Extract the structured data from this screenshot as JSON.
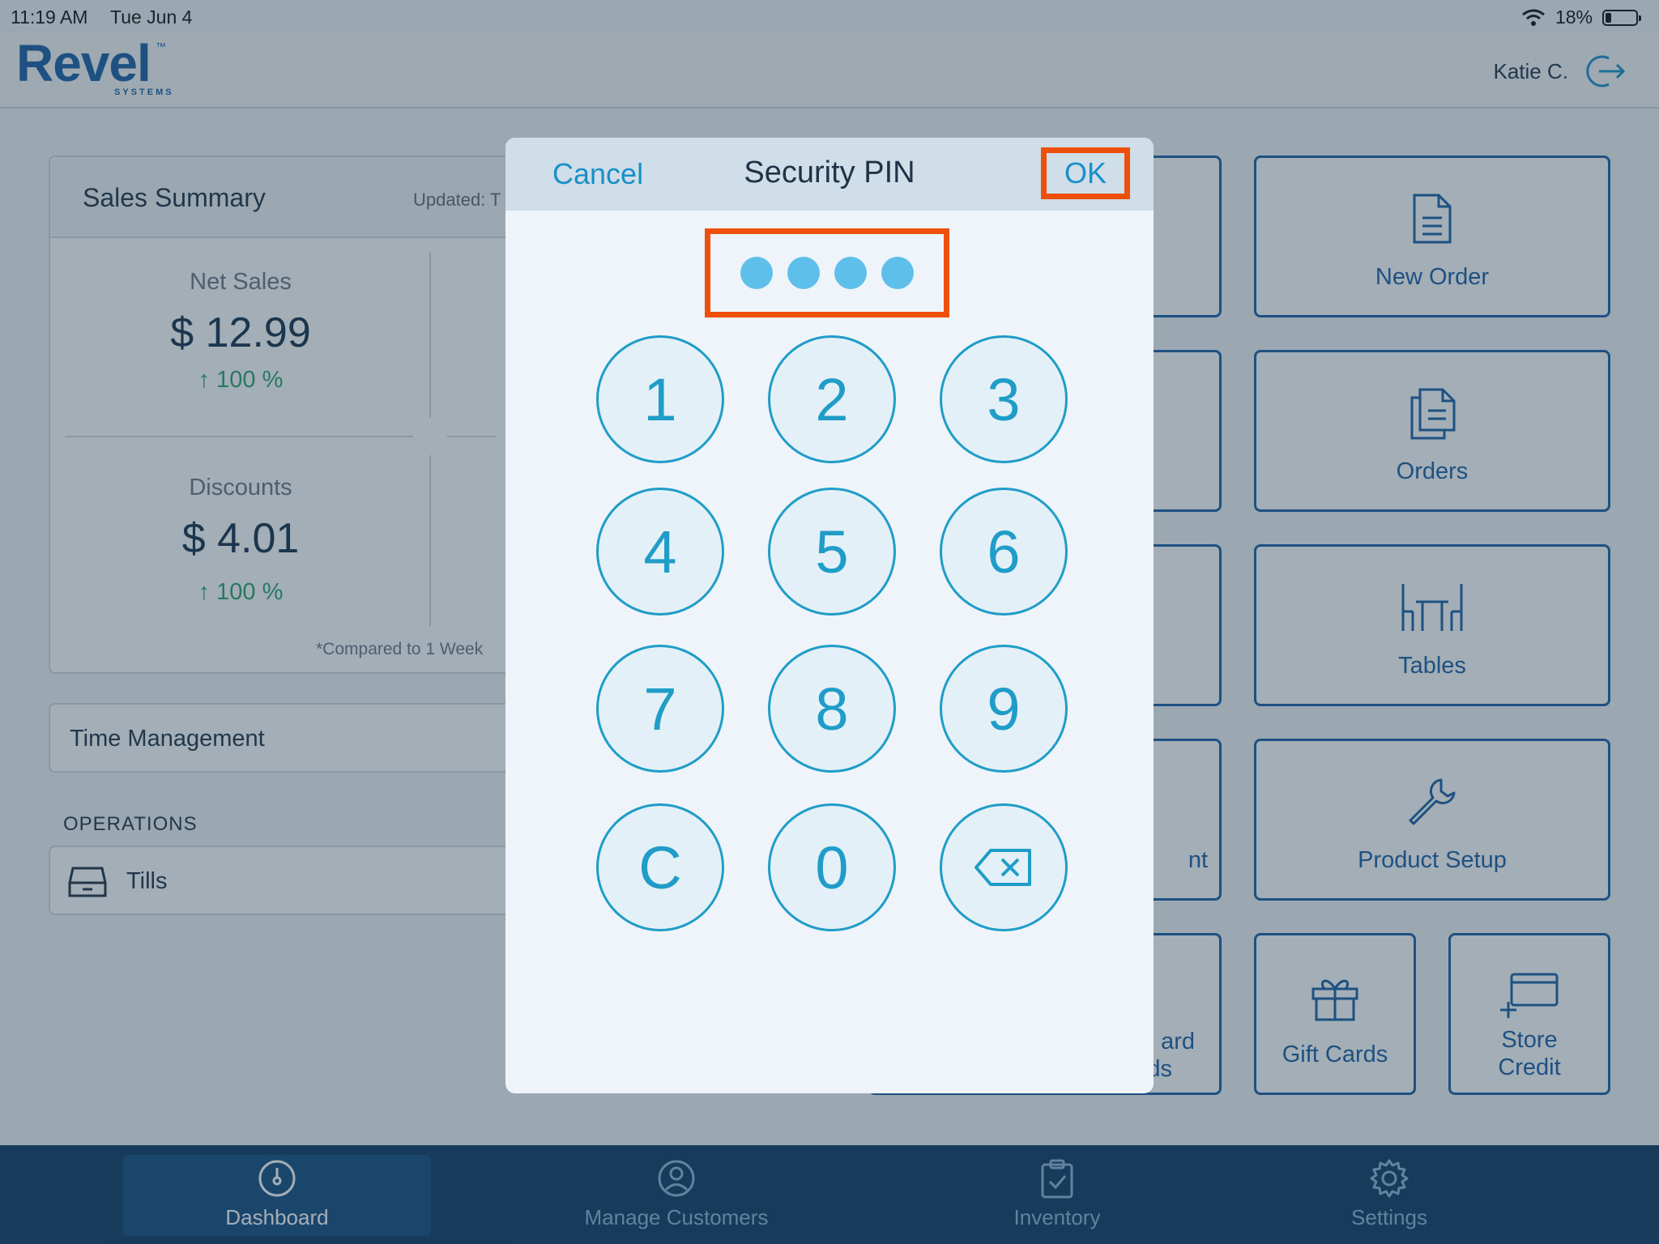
{
  "status_bar": {
    "time": "11:19 AM",
    "date": "Tue Jun 4",
    "battery": "18%",
    "battery_level": 0.18
  },
  "header": {
    "logo": "Revel",
    "logo_tm": "™",
    "logo_sub": "SYSTEMS",
    "user_name": "Katie C."
  },
  "sales_summary": {
    "title": "Sales Summary",
    "updated": "Updated: T",
    "net_sales_label": "Net Sales",
    "net_sales_value": "$ 12.99",
    "net_sales_change": "↑ 100 %",
    "discounts_label": "Discounts",
    "discounts_value": "$ 4.01",
    "discounts_change": "↑ 100 %",
    "compare_note": "*Compared to 1 Week"
  },
  "time_management": "Time Management",
  "operations": {
    "label": "OPERATIONS",
    "tills": "Tills"
  },
  "tiles": {
    "new_order": "New Order",
    "orders": "Orders",
    "tables": "Tables",
    "product_setup": "Product Setup",
    "gift_cards": "Gift Cards",
    "store_credit_1": "Store",
    "store_credit_2": "Credit",
    "partial_a": "nt",
    "partial_b1": "ard",
    "partial_b2": "ds"
  },
  "tabbar": {
    "dashboard": "Dashboard",
    "manage_customers": "Manage Customers",
    "inventory": "Inventory",
    "settings": "Settings"
  },
  "modal": {
    "title": "Security PIN",
    "cancel": "Cancel",
    "ok": "OK",
    "pin_length": 4,
    "keys": [
      "1",
      "2",
      "3",
      "4",
      "5",
      "6",
      "7",
      "8",
      "9",
      "C",
      "0"
    ]
  },
  "colors": {
    "accent": "#1a8fc9",
    "highlight": "#ee4f0a",
    "brand": "#1b5fa5",
    "tabbar": "#0e3a63"
  }
}
